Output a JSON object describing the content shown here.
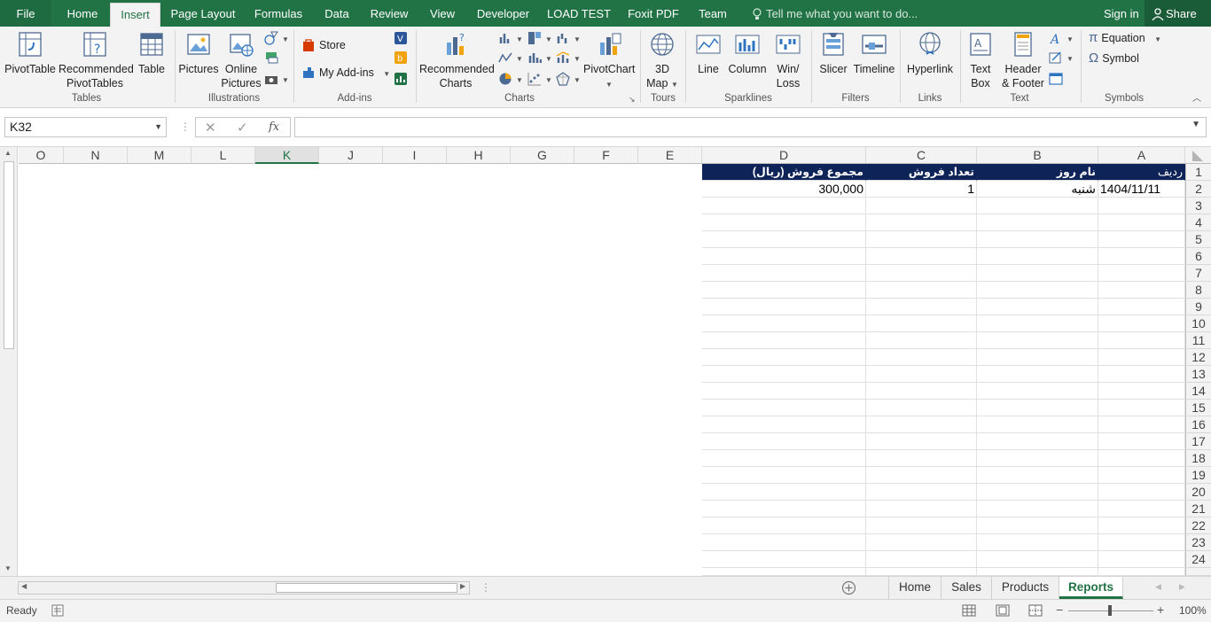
{
  "ribbon_tabs": [
    "File",
    "Home",
    "Insert",
    "Page Layout",
    "Formulas",
    "Data",
    "Review",
    "View",
    "Developer",
    "LOAD TEST",
    "Foxit PDF",
    "Team"
  ],
  "tell_me_placeholder": "Tell me what you want to do...",
  "sign_in": "Sign in",
  "share": "Share",
  "groups": {
    "tables": {
      "label": "Tables",
      "pivot": "PivotTable",
      "recommended": "Recommended",
      "recommended2": "PivotTables",
      "table": "Table"
    },
    "illustrations": {
      "label": "Illustrations",
      "pictures": "Pictures",
      "online": "Online",
      "online2": "Pictures"
    },
    "addins": {
      "label": "Add-ins",
      "store": "Store",
      "myaddins": "My Add-ins"
    },
    "charts": {
      "label": "Charts",
      "recommended": "Recommended",
      "recommended2": "Charts",
      "pivotchart": "PivotChart"
    },
    "tours": {
      "label": "Tours",
      "map": "3D",
      "map2": "Map"
    },
    "sparklines": {
      "label": "Sparklines",
      "line": "Line",
      "column": "Column",
      "winloss": "Win/",
      "winloss2": "Loss"
    },
    "filters": {
      "label": "Filters",
      "slicer": "Slicer",
      "timeline": "Timeline"
    },
    "links": {
      "label": "Links",
      "hyperlink": "Hyperlink"
    },
    "text": {
      "label": "Text",
      "textbox": "Text",
      "textbox2": "Box",
      "header": "Header",
      "header2": "& Footer"
    },
    "symbols": {
      "label": "Symbols",
      "equation": "Equation",
      "symbol": "Symbol"
    }
  },
  "name_box": "K32",
  "fx_label": "fx",
  "columns": [
    "O",
    "N",
    "M",
    "L",
    "K",
    "J",
    "I",
    "H",
    "G",
    "F",
    "E",
    "D",
    "C",
    "B",
    "A"
  ],
  "selected_column": "K",
  "rows": [
    "1",
    "2",
    "3",
    "4",
    "5",
    "6",
    "7",
    "8",
    "9",
    "10",
    "11",
    "12",
    "13",
    "14",
    "15",
    "16",
    "17",
    "18",
    "19",
    "20",
    "21",
    "22",
    "23",
    "24"
  ],
  "table": {
    "headers": {
      "A": "ردیف",
      "B": "نام روز",
      "C": "تعداد فروش",
      "D": "مجموع فروش (ریال)"
    },
    "row2": {
      "A": "1404/11/11",
      "B": "شنبه",
      "C": "1",
      "D": "300,000"
    }
  },
  "sheet_tabs": [
    "Home",
    "Sales",
    "Products",
    "Reports"
  ],
  "active_sheet": "Reports",
  "status": "Ready",
  "zoom": "100%",
  "colors": {
    "accent": "#217346",
    "header_fill": "#0e2459"
  }
}
